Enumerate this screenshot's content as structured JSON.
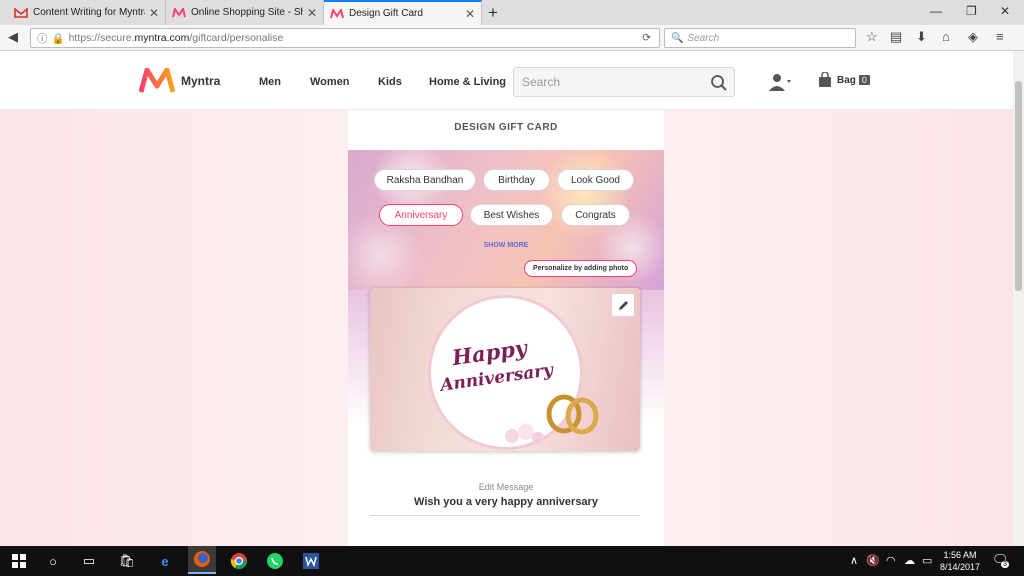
{
  "browser": {
    "tabs": [
      {
        "title": "Content Writing for Myntra",
        "favicon": "gmail-icon",
        "active": false
      },
      {
        "title": "Online Shopping Site - Shop",
        "favicon": "myntra-icon",
        "active": false
      },
      {
        "title": "Design Gift Card",
        "favicon": "myntra-icon",
        "active": true
      }
    ],
    "url_prefix": "https://secure.",
    "url_domain": "myntra.com",
    "url_path": "/giftcard/personalise",
    "search_placeholder": "Search"
  },
  "header": {
    "brand": "Myntra",
    "nav": [
      "Men",
      "Women",
      "Kids",
      "Home & Living"
    ],
    "search_placeholder": "Search",
    "bag_label": "Bag",
    "bag_count": "0"
  },
  "card": {
    "title": "DESIGN GIFT CARD",
    "occasions": [
      {
        "label": "Raksha Bandhan",
        "selected": false
      },
      {
        "label": "Birthday",
        "selected": false
      },
      {
        "label": "Look Good",
        "selected": false
      },
      {
        "label": "Anniversary",
        "selected": true
      },
      {
        "label": "Best Wishes",
        "selected": false
      },
      {
        "label": "Congrats",
        "selected": false
      }
    ],
    "show_more": "SHOW MORE",
    "personalize_tip": "Personalize by adding photo",
    "image_text_line1": "Happy",
    "image_text_line2": "Anniversary",
    "edit_message_label": "Edit Message",
    "message": "Wish you a very happy anniversary"
  },
  "taskbar": {
    "time": "1:56 AM",
    "date": "8/14/2017",
    "notification_count": "3"
  },
  "colors": {
    "accent": "#ff3f6c",
    "link": "#5d69d6",
    "greeting_text": "#7b1f5a"
  }
}
